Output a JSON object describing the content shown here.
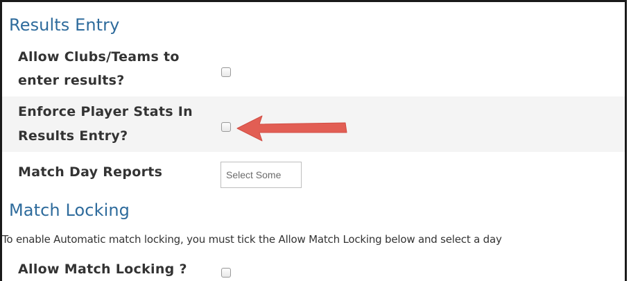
{
  "results_entry": {
    "title": "Results Entry",
    "allow_clubs_label_line1": "Allow Clubs/Teams to",
    "allow_clubs_label_line2": "enter results?",
    "allow_clubs_checked": false,
    "enforce_stats_label_line1": "Enforce Player Stats In",
    "enforce_stats_label_line2": "Results Entry?",
    "enforce_stats_checked": false,
    "match_day_reports_label": "Match Day Reports",
    "match_day_reports_placeholder": "Select Some"
  },
  "match_locking": {
    "title": "Match Locking",
    "note": "To enable Automatic match locking, you must tick the Allow Match Locking below and select a day",
    "allow_locking_label": "Allow Match Locking ?",
    "allow_locking_checked": false
  },
  "annotation": {
    "arrow_color": "#e2574c",
    "arrow_direction": "left"
  },
  "colors": {
    "section_title": "#2e6b9c",
    "label_text": "#333333",
    "shaded_row": "#f4f4f4"
  }
}
